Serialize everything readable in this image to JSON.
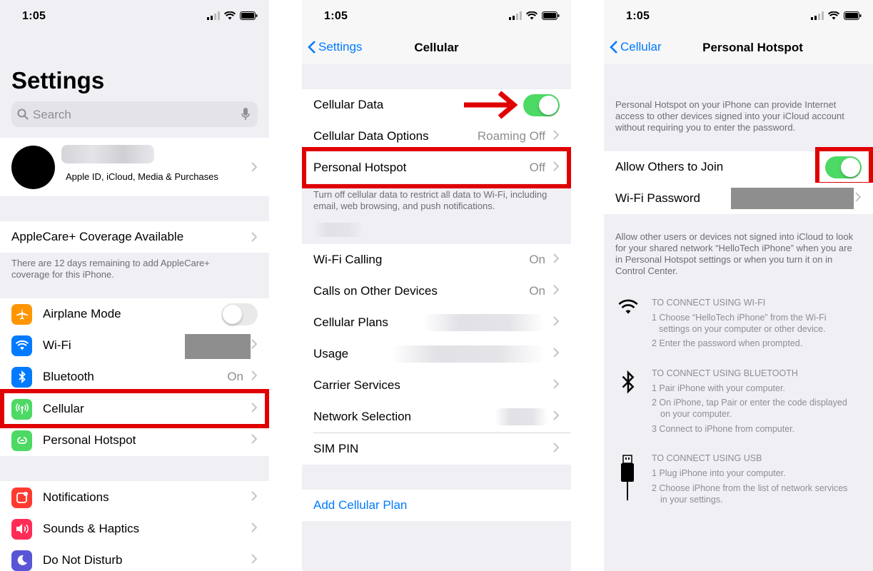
{
  "status": {
    "time": "1:05"
  },
  "colors": {
    "accent": "#007aff",
    "toggle_on": "#4cd964",
    "highlight": "#e00000"
  },
  "settings": {
    "title": "Settings",
    "search_placeholder": "Search",
    "account_subtitle": "Apple ID, iCloud, Media & Purchases",
    "applecare_label": "AppleCare+ Coverage Available",
    "applecare_note": "There are 12 days remaining to add AppleCare+ coverage for this iPhone.",
    "items": [
      {
        "label": "Airplane Mode",
        "icon": "airplane-icon",
        "color": "#ff9500",
        "value": ""
      },
      {
        "label": "Wi-Fi",
        "icon": "wifi-icon",
        "color": "#007aff",
        "value": ""
      },
      {
        "label": "Bluetooth",
        "icon": "bluetooth-icon",
        "color": "#007aff",
        "value": "On"
      },
      {
        "label": "Cellular",
        "icon": "cellular-antenna-icon",
        "color": "#4cd964",
        "value": ""
      },
      {
        "label": "Personal Hotspot",
        "icon": "hotspot-icon",
        "color": "#4cd964",
        "value": ""
      },
      {
        "label": "Notifications",
        "icon": "notifications-icon",
        "color": "#ff3b30",
        "value": ""
      },
      {
        "label": "Sounds & Haptics",
        "icon": "speaker-icon",
        "color": "#ff2d55",
        "value": ""
      },
      {
        "label": "Do Not Disturb",
        "icon": "moon-icon",
        "color": "#5856d6",
        "value": ""
      }
    ]
  },
  "cellular": {
    "back_label": "Settings",
    "title": "Cellular",
    "cellular_data_label": "Cellular Data",
    "data_options_label": "Cellular Data Options",
    "data_options_value": "Roaming Off",
    "hotspot_label": "Personal Hotspot",
    "hotspot_value": "Off",
    "note": "Turn off cellular data to restrict all data to Wi-Fi, including email, web browsing, and push notifications.",
    "rows": [
      {
        "label": "Wi-Fi Calling",
        "value": "On"
      },
      {
        "label": "Calls on Other Devices",
        "value": "On"
      },
      {
        "label": "Cellular Plans",
        "value": ""
      },
      {
        "label": "Usage",
        "value": ""
      },
      {
        "label": "Carrier Services",
        "value": ""
      },
      {
        "label": "Network Selection",
        "value": ""
      },
      {
        "label": "SIM PIN",
        "value": ""
      }
    ],
    "add_plan_label": "Add Cellular Plan"
  },
  "hotspot": {
    "back_label": "Cellular",
    "title": "Personal Hotspot",
    "intro": "Personal Hotspot on your iPhone can provide Internet access to other devices signed into your iCloud account without requiring you to enter the password.",
    "allow_label": "Allow Others to Join",
    "password_label": "Wi-Fi Password",
    "allow_note": "Allow other users or devices not signed into iCloud to look for your shared network “HelloTech iPhone” when you are in Personal Hotspot settings or when you turn it on in Control Center.",
    "wifi_head": "TO CONNECT USING WI-FI",
    "wifi_steps": [
      "1 Choose “HelloTech iPhone” from the Wi-Fi",
      "settings on your computer or other device.",
      "2 Enter the password when prompted."
    ],
    "bt_head": "TO CONNECT USING BLUETOOTH",
    "bt_steps": [
      "1 Pair iPhone with your computer.",
      "2 On iPhone, tap Pair or enter the code displayed",
      "on your computer.",
      "3 Connect to iPhone from computer."
    ],
    "usb_head": "TO CONNECT USING USB",
    "usb_steps": [
      "1 Plug iPhone into your computer.",
      "2 Choose iPhone from the list of network services",
      "in your settings."
    ]
  }
}
